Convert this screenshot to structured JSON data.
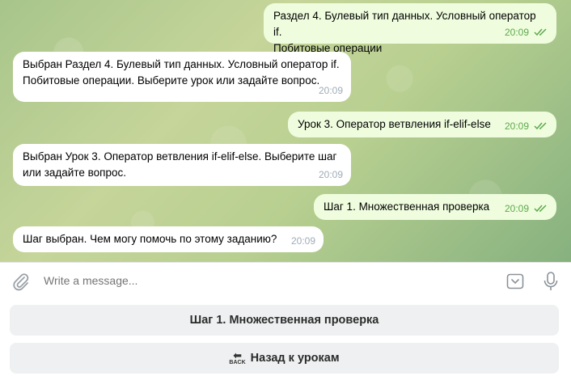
{
  "messages": [
    {
      "direction": "out",
      "text_line1": "Раздел 4. Булевый тип данных. Условный оператор if.",
      "text_line2": "Побитовые операции",
      "time": "20:09",
      "read": true
    },
    {
      "direction": "in",
      "text_line1": "Выбран Раздел 4. Булевый тип данных. Условный оператор if.",
      "text_line2": "Побитовые операции. Выберите урок или задайте вопрос.",
      "time": "20:09"
    },
    {
      "direction": "out",
      "text_line1": "Урок 3. Оператор ветвления if-elif-else",
      "time": "20:09",
      "read": true
    },
    {
      "direction": "in",
      "text_line1": "Выбран Урок 3. Оператор ветвления if-elif-else. Выберите шаг",
      "text_line2": "или задайте вопрос.",
      "time": "20:09"
    },
    {
      "direction": "out",
      "text_line1": "Шаг 1. Множественная проверка",
      "time": "20:09",
      "read": true
    },
    {
      "direction": "in",
      "text_line1": "Шаг выбран. Чем могу помочь по этому заданию?",
      "time": "20:09"
    }
  ],
  "composer": {
    "placeholder": "Write a message...",
    "attach_icon": "paperclip-icon",
    "keyboard_icon": "keyboard-toggle-icon",
    "mic_icon": "microphone-icon"
  },
  "keyboard": {
    "buttons": [
      {
        "label": "Шаг 1. Множественная проверка"
      },
      {
        "emoji_text": "BACK",
        "label": "Назад к урокам"
      }
    ]
  },
  "colors": {
    "outgoing_bubble": "#effdde",
    "incoming_bubble": "#ffffff",
    "outgoing_time": "#5fa84d",
    "incoming_time": "#a0acb6"
  }
}
